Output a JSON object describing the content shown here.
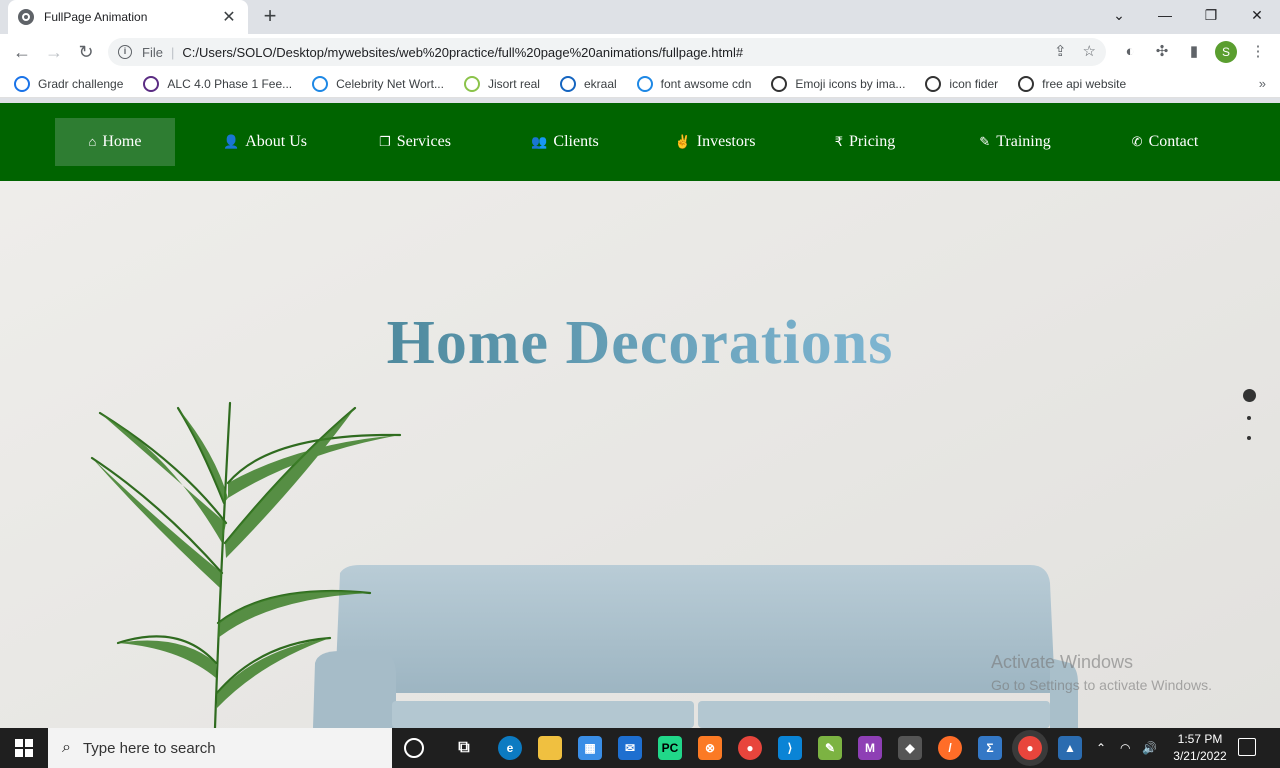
{
  "browser": {
    "tab_title": "FullPage Animation",
    "tab_close": "✕",
    "new_tab": "+",
    "window_controls": [
      "⌄",
      "—",
      "❐",
      "✕"
    ],
    "address_scheme": "File",
    "address_url": "C:/Users/SOLO/Desktop/mywebsites/web%20practice/full%20page%20animations/fullpage.html#",
    "profile_initial": "S"
  },
  "bookmarks": [
    {
      "label": "Gradr challenge",
      "icon": "gradr-icon",
      "color": "#1a73e8"
    },
    {
      "label": "ALC 4.0 Phase 1 Fee...",
      "icon": "alc-icon",
      "color": "#5b2c83"
    },
    {
      "label": "Celebrity Net Wort...",
      "icon": "crown-icon",
      "color": "#1e88e5"
    },
    {
      "label": "Jisort real",
      "icon": "jisort-icon",
      "color": "#8bc34a"
    },
    {
      "label": "ekraal",
      "icon": "ekraal-icon",
      "color": "#1565c0"
    },
    {
      "label": "font awsome cdn",
      "icon": "bootstrap-icon",
      "color": "#1e88e5"
    },
    {
      "label": "Emoji icons by ima...",
      "icon": "emoji-icon",
      "color": "#333333"
    },
    {
      "label": "icon fider",
      "icon": "iconfinder-icon",
      "color": "#333333"
    },
    {
      "label": "free api website",
      "icon": "api-icon",
      "color": "#333333"
    }
  ],
  "page": {
    "nav": [
      {
        "label": "Home",
        "icon": "home-icon",
        "glyph": "⌂",
        "active": true
      },
      {
        "label": "About Us",
        "icon": "user-icon",
        "glyph": "👤",
        "active": false
      },
      {
        "label": "Services",
        "icon": "clone-icon",
        "glyph": "❐",
        "active": false
      },
      {
        "label": "Clients",
        "icon": "users-icon",
        "glyph": "👥",
        "active": false
      },
      {
        "label": "Investors",
        "icon": "hand-peace-icon",
        "glyph": "✌",
        "active": false
      },
      {
        "label": "Pricing",
        "icon": "rupee-icon",
        "glyph": "₹",
        "active": false
      },
      {
        "label": "Training",
        "icon": "edit-icon",
        "glyph": "✎",
        "active": false
      },
      {
        "label": "Contact",
        "icon": "phone-icon",
        "glyph": "✆",
        "active": false
      }
    ],
    "hero_title": "Home Decorations",
    "section_dots": [
      {
        "active": true
      },
      {
        "active": false
      },
      {
        "active": false
      }
    ],
    "colors": {
      "navbar": "#006400",
      "nav_active": "#2e7d32",
      "title_start": "#4f8a9e",
      "title_end": "#7fb6d2"
    }
  },
  "watermark": {
    "line1": "Activate Windows",
    "line2": "Go to Settings to activate Windows."
  },
  "taskbar": {
    "search_placeholder": "Type here to search",
    "time": "1:57 PM",
    "date": "3/21/2022"
  }
}
